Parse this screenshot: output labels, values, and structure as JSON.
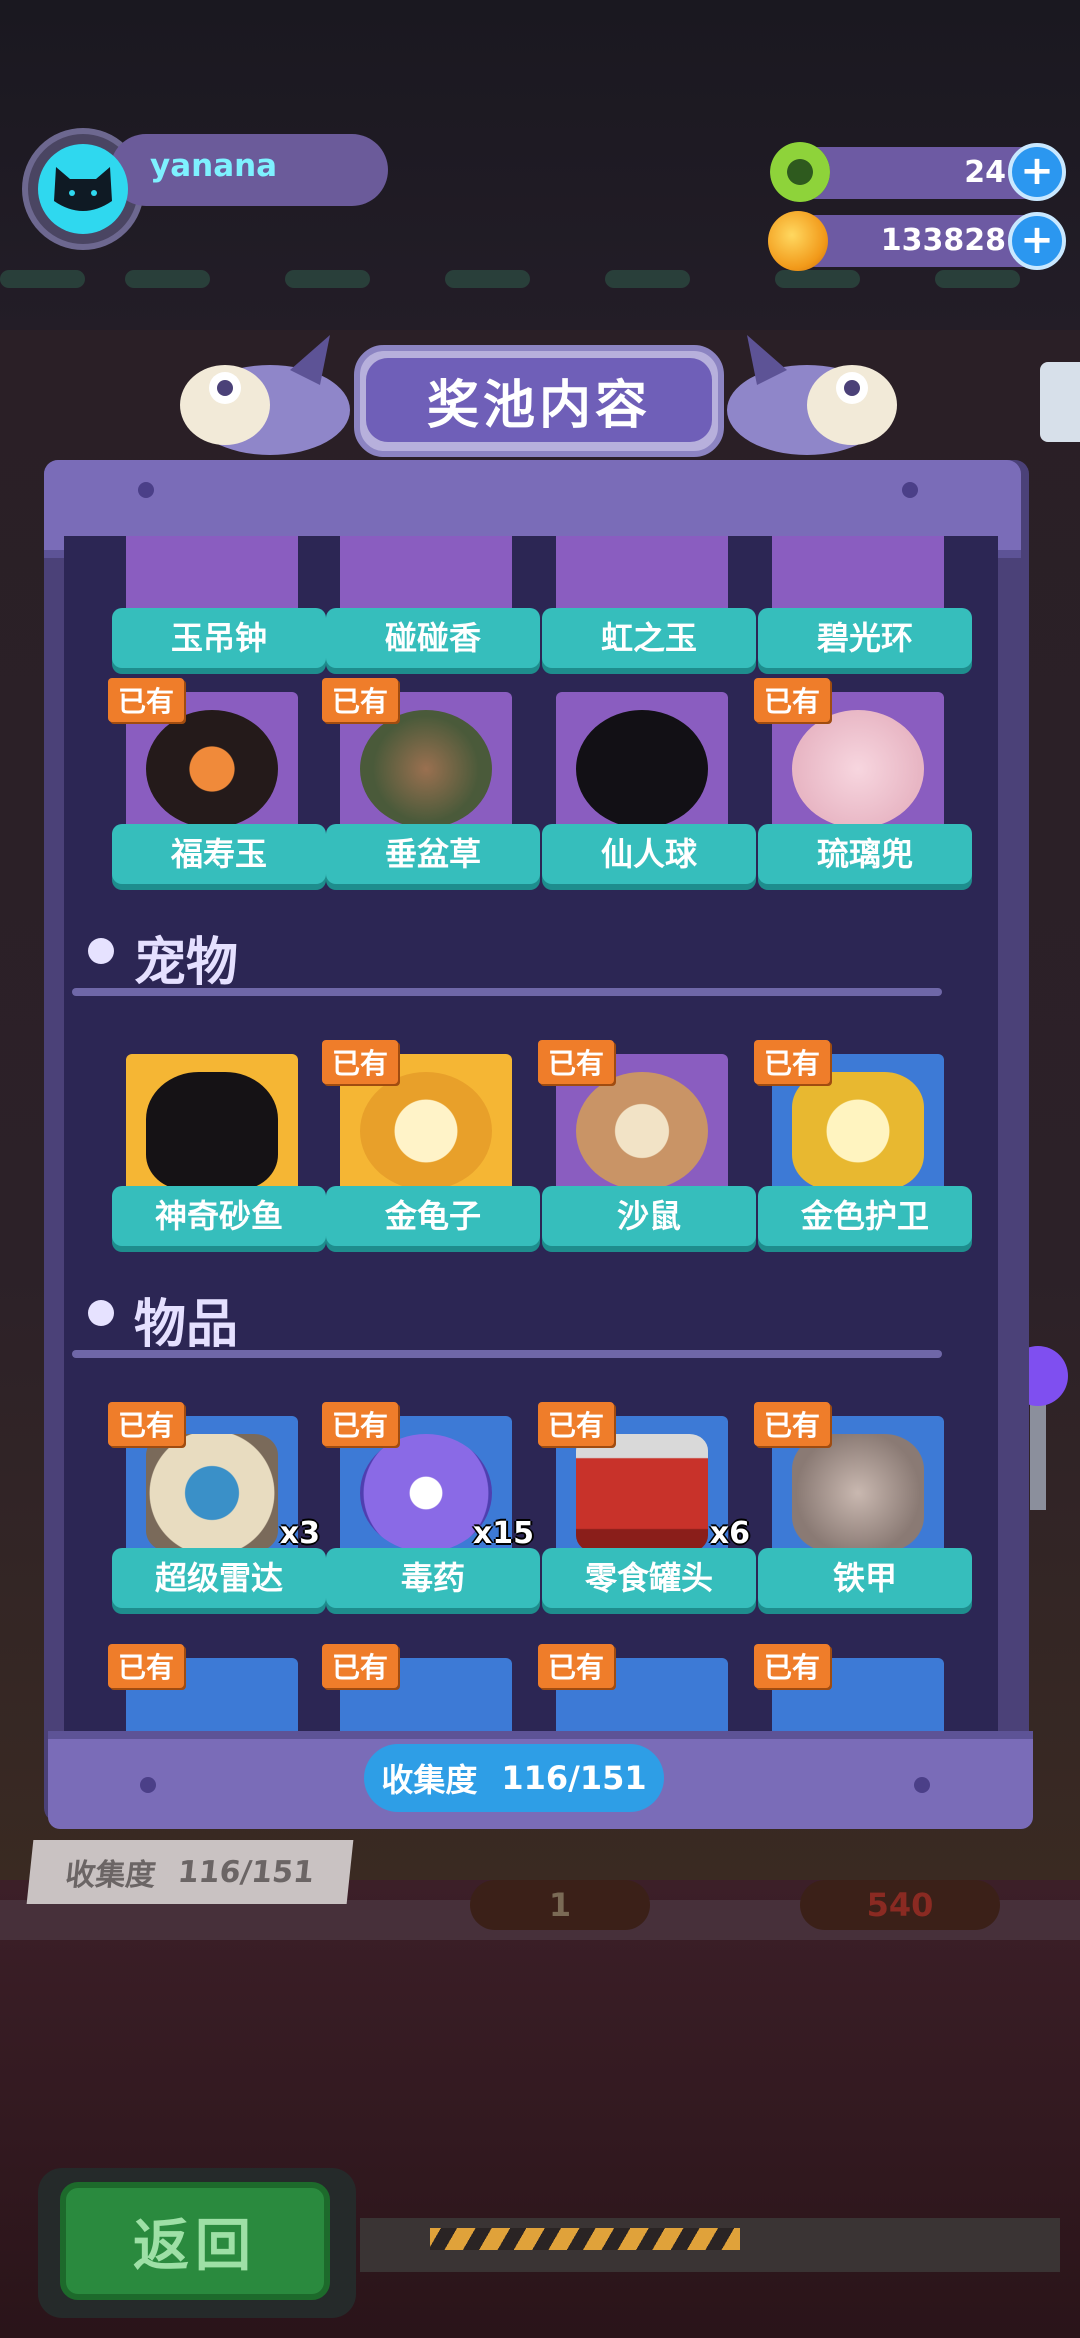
{
  "header": {
    "username": "yanana",
    "currency_green": "24",
    "currency_gold": "133828"
  },
  "panel": {
    "title": "奖池内容",
    "progress_label": "收集度",
    "progress_value": "116/151",
    "progress_fraction": 0.768
  },
  "owned_badge": "已有",
  "rows": {
    "partial_top": [
      "玉吊钟",
      "碰碰香",
      "虹之玉",
      "碧光环"
    ],
    "plants": [
      {
        "name": "福寿玉",
        "owned": true
      },
      {
        "name": "垂盆草",
        "owned": true
      },
      {
        "name": "仙人球",
        "owned": false
      },
      {
        "name": "琉璃兜",
        "owned": true
      }
    ]
  },
  "sections": {
    "pets": {
      "title": "宠物",
      "items": [
        {
          "name": "神奇砂鱼",
          "owned": false
        },
        {
          "name": "金龟子",
          "owned": true
        },
        {
          "name": "沙鼠",
          "owned": true
        },
        {
          "name": "金色护卫",
          "owned": true
        }
      ]
    },
    "items": {
      "title": "物品",
      "items": [
        {
          "name": "超级雷达",
          "owned": true,
          "qty": "x3"
        },
        {
          "name": "毒药",
          "owned": true,
          "qty": "x15"
        },
        {
          "name": "零食罐头",
          "owned": true,
          "qty": "x6"
        },
        {
          "name": "铁甲",
          "owned": true,
          "qty": ""
        }
      ]
    }
  },
  "background": {
    "progress_label": "收集度",
    "progress_value": "116/151",
    "count": "1",
    "price": "540"
  },
  "back_button": "返回",
  "colors": {
    "accent_purple": "#7a6cb8",
    "label_teal": "#36bebc",
    "owned_orange": "#ef7d2a",
    "progress_blue": "#2e9ee6",
    "back_green": "#2a8a3e"
  }
}
